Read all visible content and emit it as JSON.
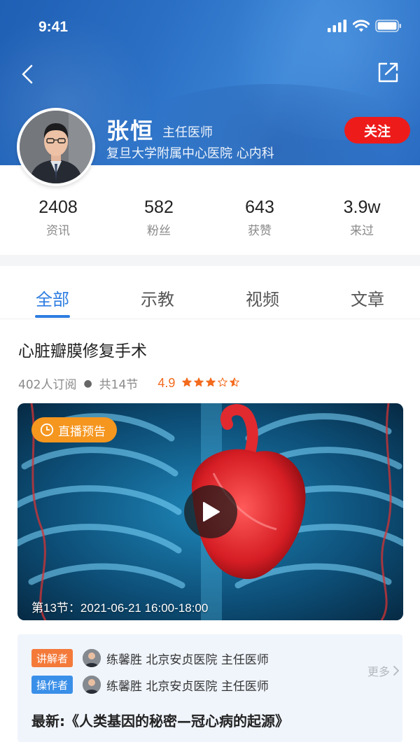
{
  "status_bar": {
    "time": "9:41"
  },
  "doctor": {
    "name": "张恒",
    "title": "主任医师",
    "hospital": "复旦大学附属中心医院 心内科",
    "follow_label": "关注"
  },
  "stats": [
    {
      "value": "2408",
      "label": "资讯"
    },
    {
      "value": "582",
      "label": "粉丝"
    },
    {
      "value": "643",
      "label": "获赞"
    },
    {
      "value": "3.9w",
      "label": "来过"
    }
  ],
  "tabs": [
    {
      "label": "全部",
      "active": true
    },
    {
      "label": "示教",
      "active": false
    },
    {
      "label": "视频",
      "active": false
    },
    {
      "label": "文章",
      "active": false
    }
  ],
  "course": {
    "title": "心脏瓣膜修复手术",
    "subscribers": "402人订阅",
    "sessions": "共14节",
    "rating": "4.9",
    "stars": 4.5,
    "live_badge": "直播预告",
    "session_time": "第13节：2021-06-21  16:00-18:00"
  },
  "info": {
    "lecturer_tag": "讲解者",
    "lecturer": "练馨胜  北京安贞医院  主任医师",
    "operator_tag": "操作者",
    "operator": "练馨胜  北京安贞医院  主任医师",
    "more_label": "更多",
    "latest": "最新:《人类基因的秘密—冠心病的起源》"
  },
  "colors": {
    "accent": "#2e7de1",
    "follow": "#ee1b1b",
    "rating": "#f26b1d",
    "live_badge": "#f5961f"
  }
}
